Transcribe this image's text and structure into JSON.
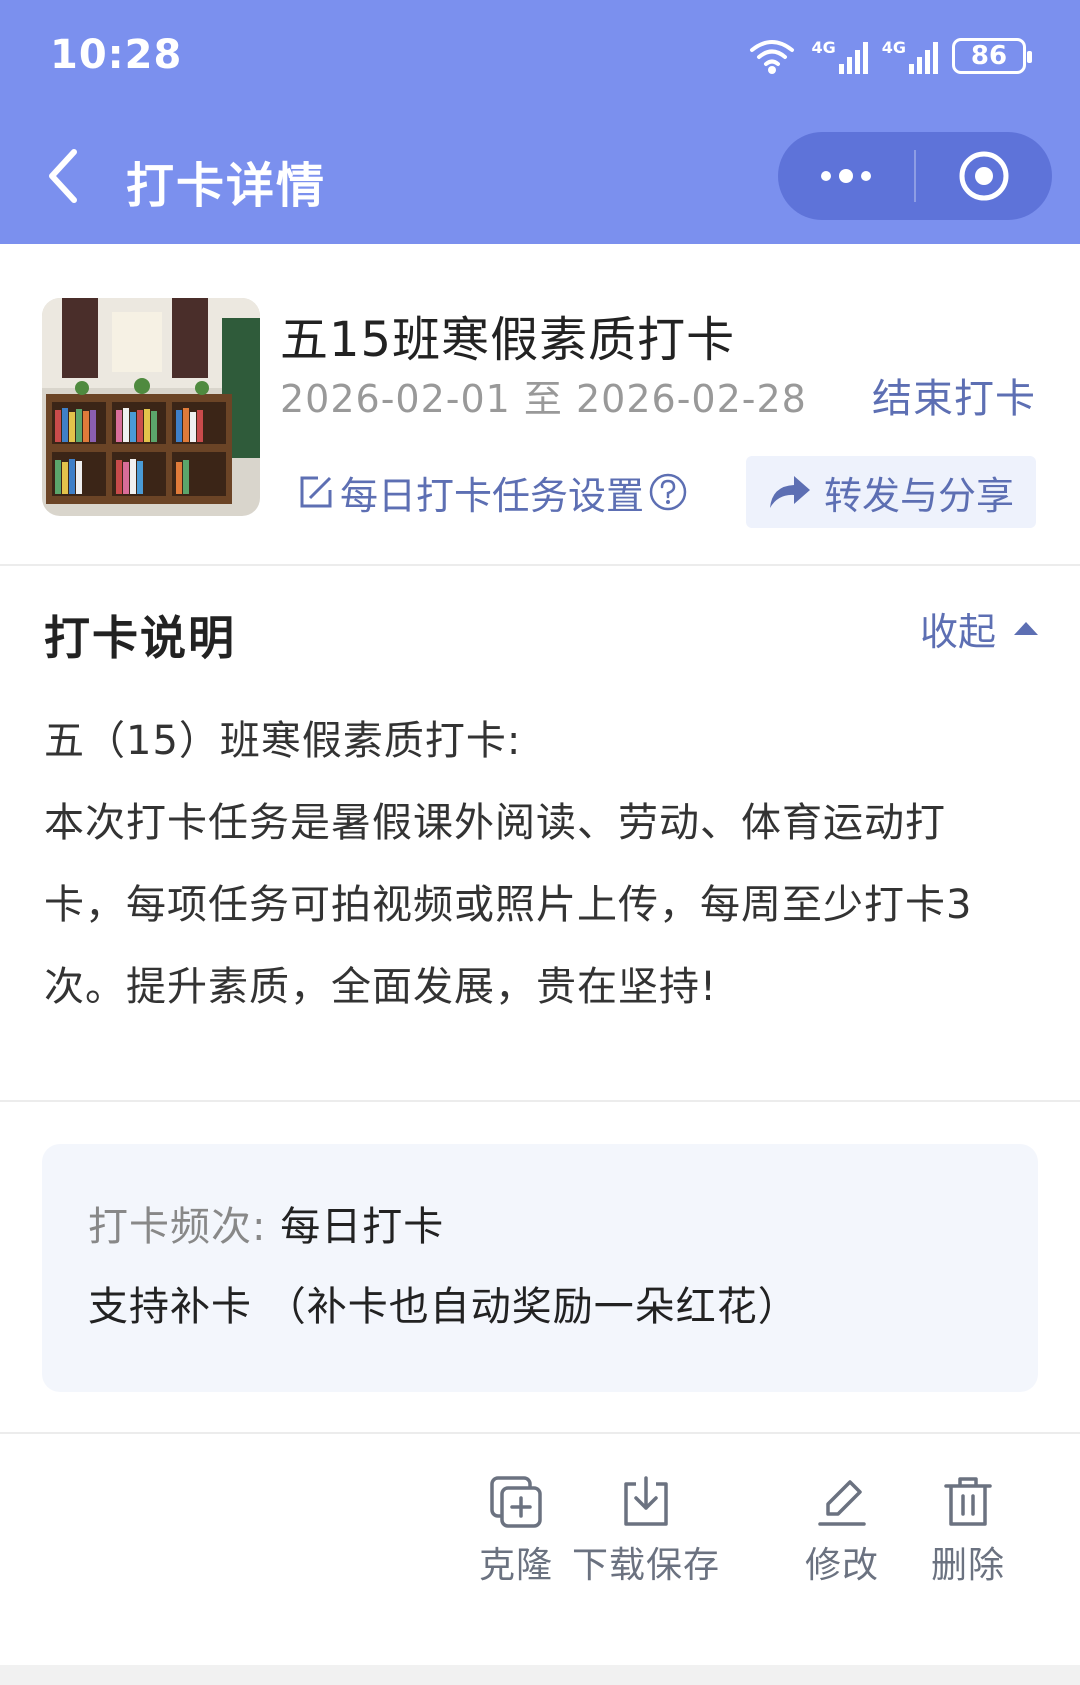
{
  "status_bar": {
    "time": "10:28",
    "battery": "86",
    "signal_labels": [
      "4G",
      "4G"
    ]
  },
  "nav": {
    "title": "打卡详情"
  },
  "card": {
    "title": "五15班寒假素质打卡",
    "date_range": "2026-02-01 至 2026-02-28",
    "end_label": "结束打卡",
    "task_settings_label": "每日打卡任务设置",
    "share_label": "转发与分享"
  },
  "description": {
    "heading": "打卡说明",
    "collapse_label": "收起",
    "lines": [
      "五（15）班寒假素质打卡:",
      "本次打卡任务是暑假课外阅读、劳动、体育运动打",
      "卡，每项任务可拍视频或照片上传，每周至少打卡3",
      "次。提升素质，全面发展，贵在坚持!"
    ]
  },
  "info": {
    "frequency_label": "打卡频次:",
    "frequency_value": "每日打卡",
    "makeup_text": "支持补卡 （补卡也自动奖励一朵红花）"
  },
  "toolbar": {
    "clone": "克隆",
    "download": "下载保存",
    "edit": "修改",
    "delete": "删除"
  },
  "colors": {
    "header": "#7b90ee",
    "accent": "#5d6fb3",
    "info_bg": "#f3f6fc"
  }
}
